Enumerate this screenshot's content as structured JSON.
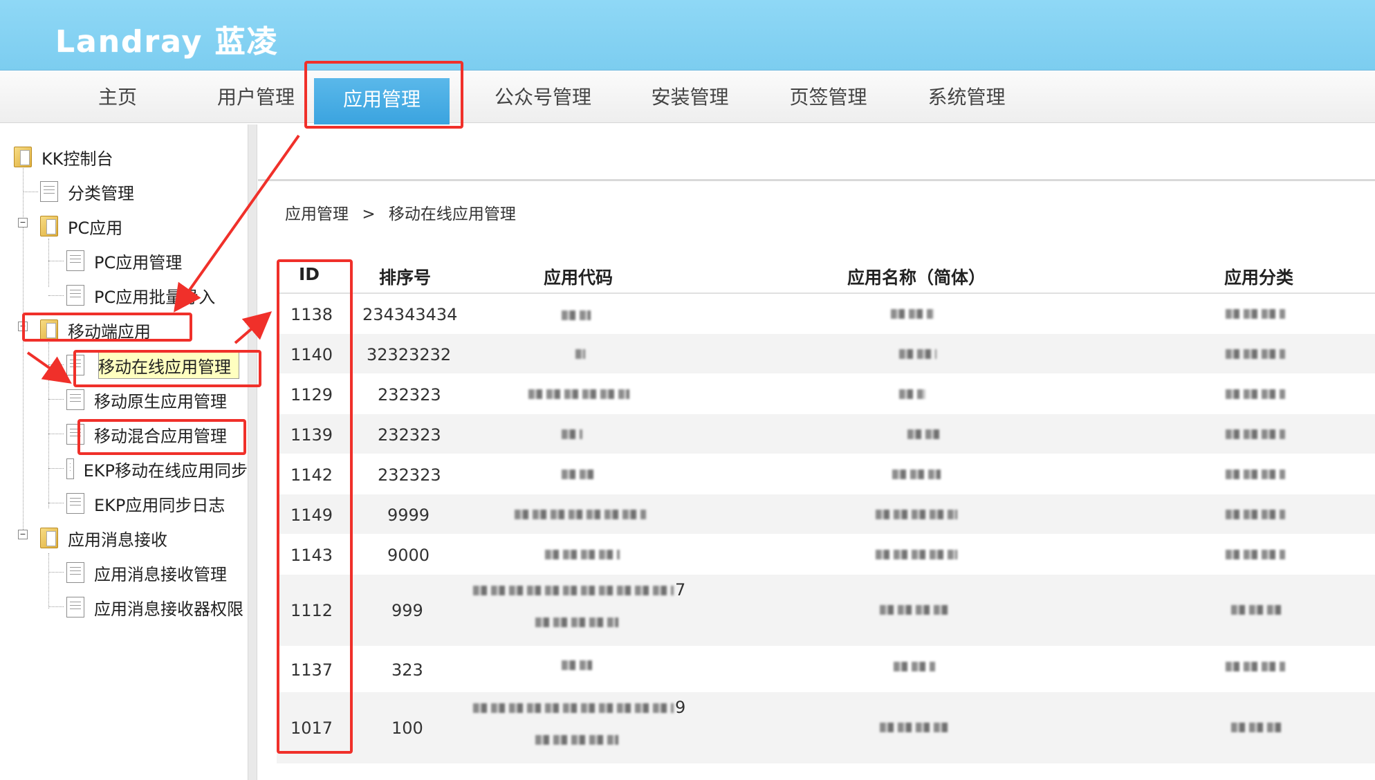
{
  "header": {
    "logo_text": "Landray 蓝凌"
  },
  "nav": {
    "items": [
      {
        "label": "主页"
      },
      {
        "label": "用户管理"
      },
      {
        "label": "应用管理",
        "active": true
      },
      {
        "label": "公众号管理"
      },
      {
        "label": "安装管理"
      },
      {
        "label": "页签管理"
      },
      {
        "label": "系统管理"
      }
    ]
  },
  "sidebar": {
    "root": "KK控制台",
    "items": [
      "分类管理",
      "PC应用",
      "PC应用管理",
      "PC应用批量导入",
      "移动端应用",
      "移动在线应用管理",
      "移动原生应用管理",
      "移动混合应用管理",
      "EKP移动在线应用同步",
      "EKP应用同步日志",
      "应用消息接收",
      "应用消息接收管理",
      "应用消息接收器权限"
    ]
  },
  "breadcrumb": {
    "parent": "应用管理",
    "sep": ">",
    "current": "移动在线应用管理"
  },
  "table": {
    "headers": {
      "id": "ID",
      "order": "排序号",
      "code": "应用代码",
      "name": "应用名称（简体）",
      "category": "应用分类"
    },
    "rows": [
      {
        "id": "1138",
        "order": "234343434"
      },
      {
        "id": "1140",
        "order": "32323232"
      },
      {
        "id": "1129",
        "order": "232323"
      },
      {
        "id": "1139",
        "order": "232323"
      },
      {
        "id": "1142",
        "order": "232323"
      },
      {
        "id": "1149",
        "order": "9999"
      },
      {
        "id": "1143",
        "order": "9000"
      },
      {
        "id": "1112",
        "order": "999",
        "code_suffix": "7"
      },
      {
        "id": "1137",
        "order": "323"
      },
      {
        "id": "1017",
        "order": "100",
        "code_suffix": "9"
      }
    ]
  },
  "colors": {
    "banner": "#7ccdf0",
    "active_tab": "#3aa3df",
    "annotation": "#f0302a"
  }
}
